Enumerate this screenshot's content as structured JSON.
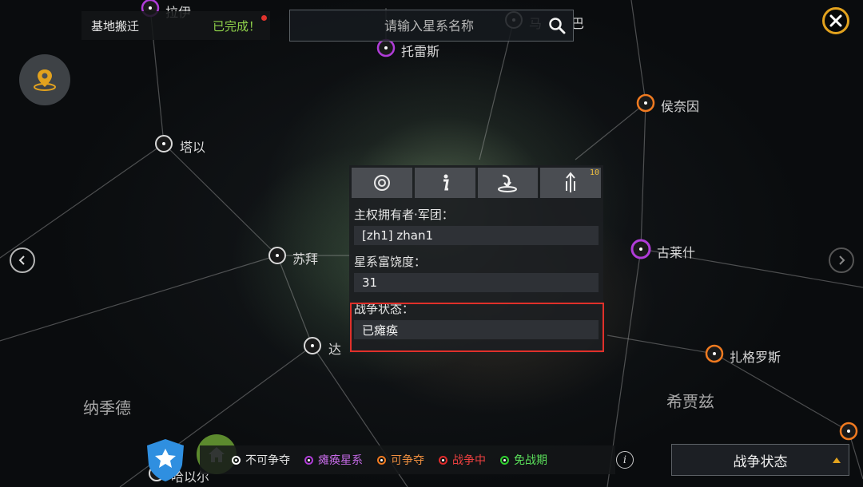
{
  "task": {
    "name": "基地搬迁",
    "status": "已完成！"
  },
  "search": {
    "placeholder": "请输入星系名称"
  },
  "nodes": [
    {
      "name": "拉伊",
      "type": "purple"
    },
    {
      "name": "托雷斯",
      "type": "purple"
    },
    {
      "name": "马",
      "type": "white"
    },
    {
      "name": "巴",
      "type": "white"
    },
    {
      "name": "侯奈因",
      "type": "orange"
    },
    {
      "name": "塔以",
      "type": "white"
    },
    {
      "name": "苏拜",
      "type": "white"
    },
    {
      "name": "古莱什",
      "type": "purple"
    },
    {
      "name": "达",
      "type": "white"
    },
    {
      "name": "扎格罗斯",
      "type": "orange"
    },
    {
      "name": "哈以尔",
      "type": "white"
    },
    {
      "name": "",
      "type": "orange"
    }
  ],
  "regions": [
    "纳季德",
    "希贾兹"
  ],
  "panel": {
    "tabs": [
      {
        "icon": "target-icon"
      },
      {
        "icon": "info-icon"
      },
      {
        "icon": "landing-icon"
      },
      {
        "icon": "upgrade-icon",
        "badge": "10"
      }
    ],
    "owner_label": "主权拥有者·军团：",
    "owner_value": "[zh1] zhan1",
    "richness_label": "星系富饶度：",
    "richness_value": "31",
    "war_label": "战争状态：",
    "war_value": "已瘫痪"
  },
  "legend": [
    {
      "label": "不可争夺",
      "color": "#ffffff"
    },
    {
      "label": "瘫痪星系",
      "color": "#b03cd8"
    },
    {
      "label": "可争夺",
      "color": "#f07a20"
    },
    {
      "label": "战争中",
      "color": "#e02a2a"
    },
    {
      "label": "免战期",
      "color": "#2fd02f"
    }
  ],
  "war_button": {
    "label": "战争状态"
  },
  "colors": {
    "accent": "#e2a21e",
    "completed": "#8fd14a",
    "highlight": "#e0302a"
  }
}
